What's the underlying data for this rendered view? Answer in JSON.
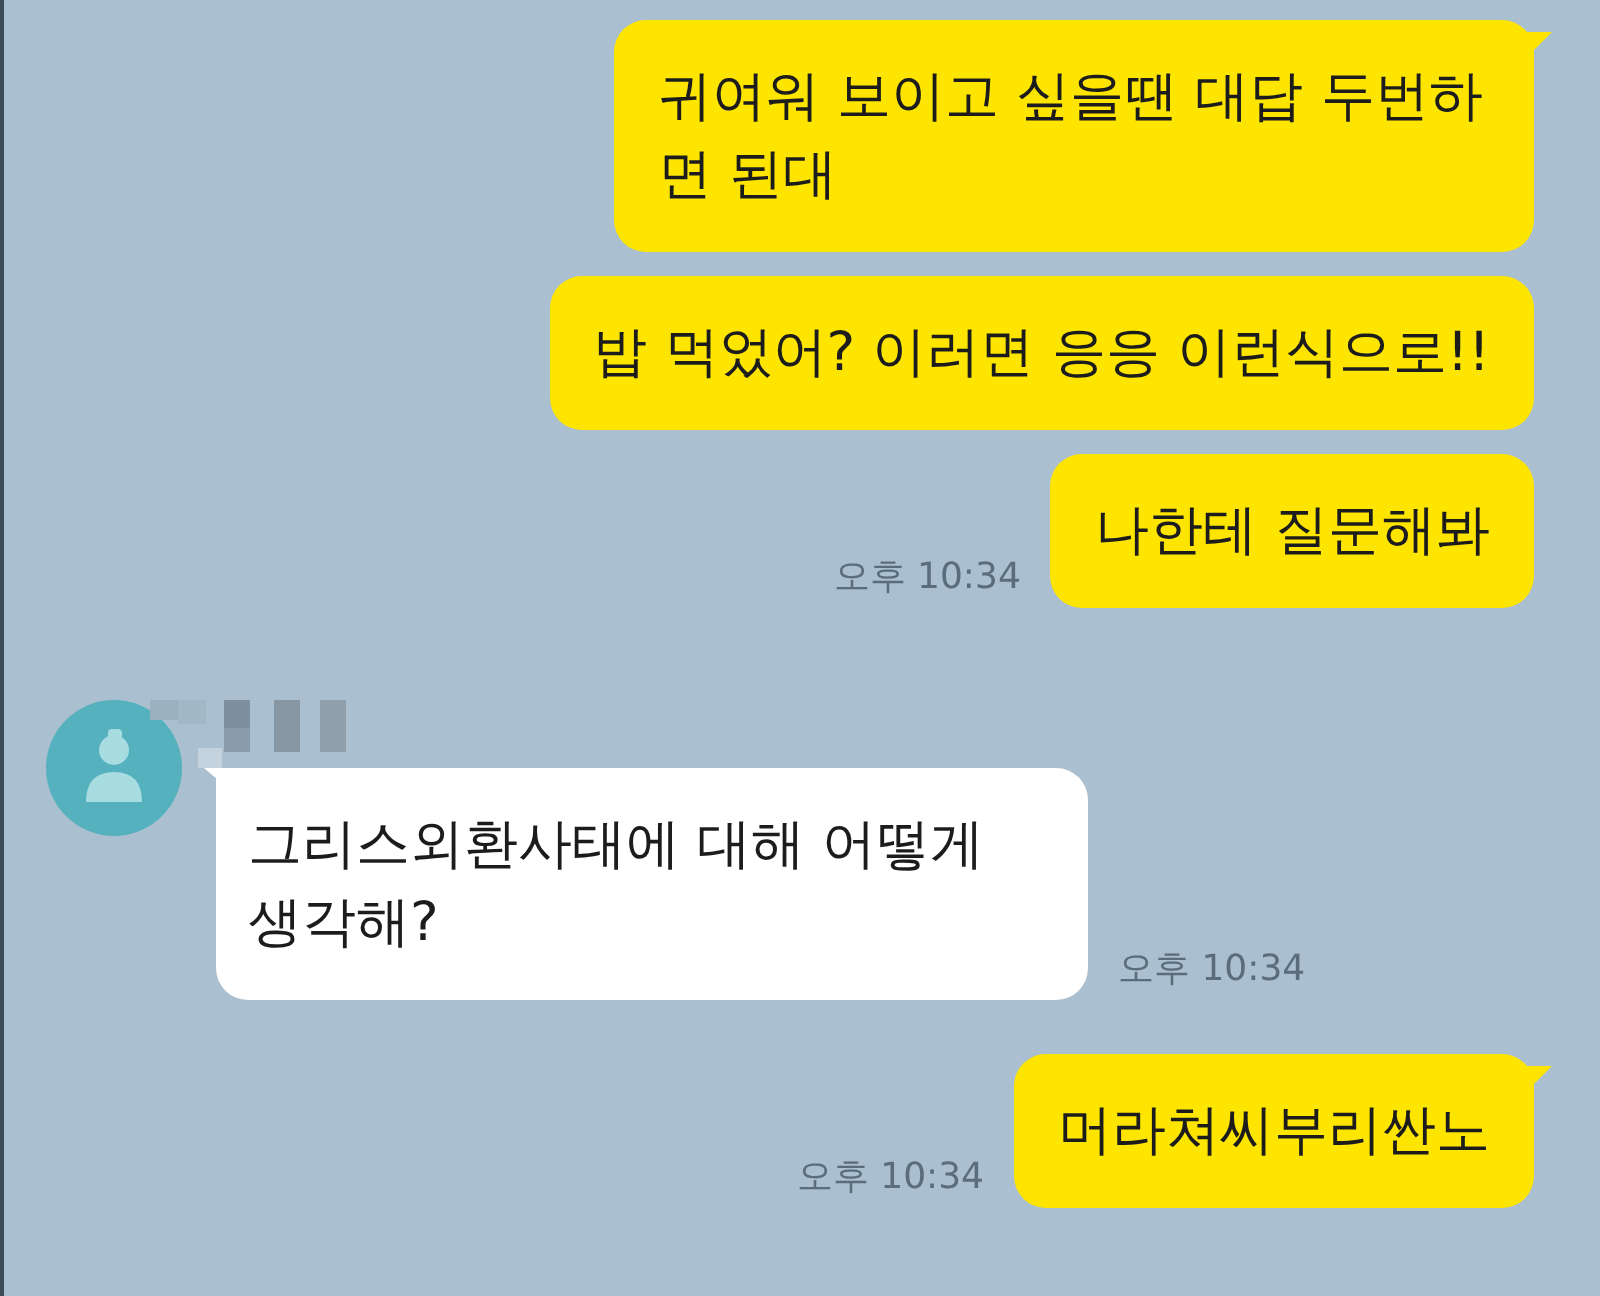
{
  "chat": {
    "groups": [
      {
        "kind": "outgoing",
        "messages": [
          "귀여워 보이고 싶을땐 대답 두번하면 된대",
          "밥 먹었어? 이러면 응응 이런식으로!!",
          "나한테 질문해봐"
        ],
        "time": "오후 10:34"
      },
      {
        "kind": "incoming",
        "messages": [
          "그리스외환사태에 대해 어떻게 생각해?"
        ],
        "time": "오후 10:34"
      },
      {
        "kind": "outgoing",
        "messages": [
          "머라쳐씨부리싼노"
        ],
        "time": "오후 10:34"
      }
    ]
  }
}
